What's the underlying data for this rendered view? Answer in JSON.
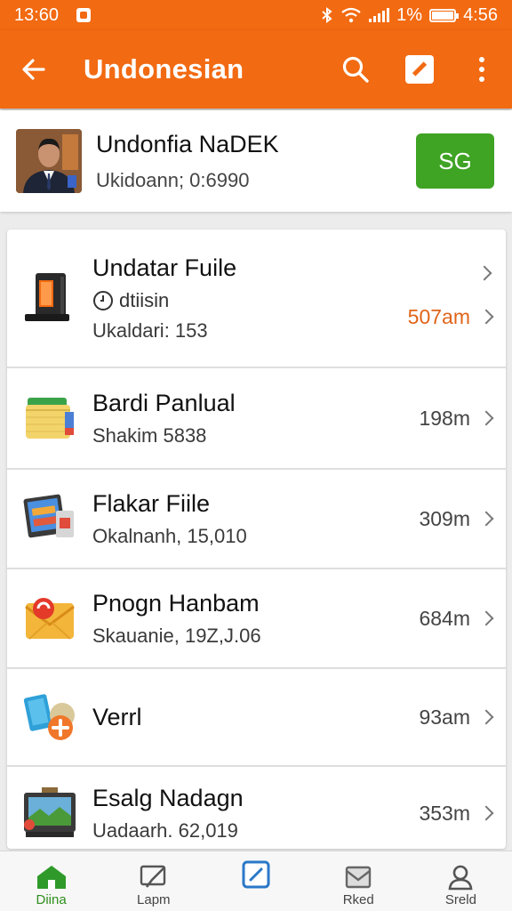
{
  "status_bar": {
    "time_left": "13:60",
    "battery": "1%",
    "time_right": "4:56"
  },
  "app_bar": {
    "title": "Undonesian",
    "icons": [
      "back-arrow-icon",
      "search-icon",
      "edit-icon",
      "more-vert-icon"
    ]
  },
  "profile": {
    "name": "Undonfia NaDEK",
    "subtitle": "Ukidoann; 0:6990",
    "button_label": "SG"
  },
  "files": [
    {
      "title": "Undatar Fuile",
      "meta": "dtiisin",
      "subtitle": "Ukaldari: 153",
      "size": "507am",
      "size_color": "#e0641a",
      "icon": "device-icon"
    },
    {
      "title": "Bardi Panlual",
      "subtitle": "Shakim 5838",
      "size": "198m",
      "icon": "folder-icon"
    },
    {
      "title": "Flakar Fiile",
      "subtitle": "Okalnanh, 15,010",
      "size": "309m",
      "icon": "tablet-icon"
    },
    {
      "title": "Pnogn Hanbam",
      "subtitle": "Skauanie, 19Z,J.06",
      "size": "684m",
      "icon": "mail-icon"
    },
    {
      "title": "Verrl",
      "subtitle": "",
      "size": "93am",
      "icon": "transfer-icon"
    },
    {
      "title": "Esalg Nadagn",
      "subtitle": "Uadaarh. 62,019",
      "size": "353m",
      "icon": "tv-icon"
    }
  ],
  "bottom_nav": [
    {
      "label": "Diina",
      "icon": "home-icon",
      "active": true
    },
    {
      "label": "Lapm",
      "icon": "pen-icon",
      "active": false
    },
    {
      "label": "",
      "icon": "compose-icon",
      "active": false
    },
    {
      "label": "Rked",
      "icon": "inbox-icon",
      "active": false
    },
    {
      "label": "Sreld",
      "icon": "person-icon",
      "active": false
    }
  ],
  "colors": {
    "brand": "#f26a12",
    "accent_green": "#3fa324",
    "size_accent": "#e0641a"
  }
}
